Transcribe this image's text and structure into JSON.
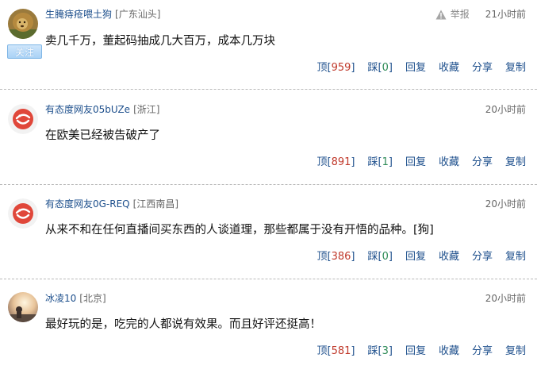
{
  "comments": [
    {
      "username": "生腌痔疮喂土狗",
      "location": "[广东汕头]",
      "time": "21小时前",
      "report_label": "举报",
      "follow_label": "关注",
      "content": "卖几千万，董起码抽成几大百万，成本几万块",
      "up_label": "顶",
      "up_count": "959",
      "down_label": "踩",
      "down_count": "0",
      "reply_label": "回复",
      "fav_label": "收藏",
      "share_label": "分享",
      "copy_label": "复制",
      "avatar": "lion-avatar"
    },
    {
      "username": "有态度网友05bUZe",
      "location": "[浙江]",
      "time": "20小时前",
      "content": "在欧美已经被告破产了",
      "up_label": "顶",
      "up_count": "891",
      "down_label": "踩",
      "down_count": "1",
      "reply_label": "回复",
      "fav_label": "收藏",
      "share_label": "分享",
      "copy_label": "复制",
      "avatar": "netease-default-avatar"
    },
    {
      "username": "有态度网友0G-REQ",
      "location": "[江西南昌]",
      "time": "20小时前",
      "content": "从来不和在任何直播间买东西的人谈道理，那些都属于没有开悟的品种。[狗]",
      "up_label": "顶",
      "up_count": "386",
      "down_label": "踩",
      "down_count": "0",
      "reply_label": "回复",
      "fav_label": "收藏",
      "share_label": "分享",
      "copy_label": "复制",
      "avatar": "netease-default-avatar"
    },
    {
      "username": "冰凌10",
      "location": "[北京]",
      "time": "20小时前",
      "content": "最好玩的是，吃完的人都说有效果。而且好评还挺高！",
      "up_label": "顶",
      "up_count": "581",
      "down_label": "踩",
      "down_count": "3",
      "reply_label": "回复",
      "fav_label": "收藏",
      "share_label": "分享",
      "copy_label": "复制",
      "avatar": "sunset-photo-avatar"
    }
  ],
  "colors": {
    "link": "#1d4f8c",
    "count": "#c0392b",
    "down_count": "#2e8b57",
    "divider": "#b9b9b9"
  }
}
